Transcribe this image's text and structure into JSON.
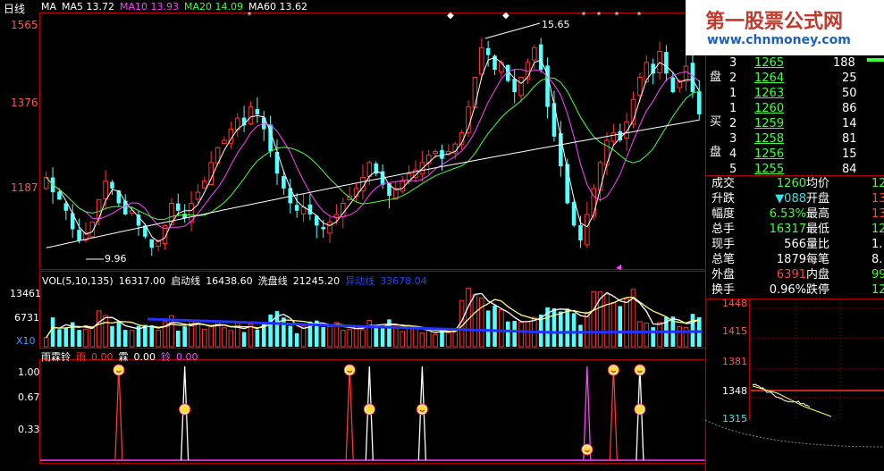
{
  "period": "日线",
  "ma_legend": [
    {
      "label": "MA",
      "color": "#ffffff"
    },
    {
      "label": "MA5 13.72",
      "color": "#ffffff"
    },
    {
      "label": "MA10 13.93",
      "color": "#ff44ff"
    },
    {
      "label": "MA20 14.09",
      "color": "#44ff44"
    },
    {
      "label": "MA60 13.62",
      "color": "#ffffff"
    }
  ],
  "price_axis": [
    "1565",
    "1376",
    "1187"
  ],
  "annotations": {
    "high": "15.65",
    "low": "9.96"
  },
  "vol_legend": [
    {
      "label": "VOL(5,10,135)",
      "color": "#ffffff"
    },
    {
      "label": "16317.00",
      "color": "#ffffff"
    },
    {
      "label": "启动线",
      "color": "#ffffff"
    },
    {
      "label": "16438.60",
      "color": "#ffffff"
    },
    {
      "label": "洗盘线",
      "color": "#ffffff"
    },
    {
      "label": "21245.20",
      "color": "#ffffff"
    },
    {
      "label": "异动线",
      "color": "#2244ff"
    },
    {
      "label": "33678.04",
      "color": "#2244ff"
    }
  ],
  "vol_axis": [
    "13461",
    "6731",
    "X10"
  ],
  "ind_legend": [
    {
      "label": "雨霖铃",
      "color": "#ffffff"
    },
    {
      "label": "雨",
      "color": "#ff3333"
    },
    {
      "label": "0.00",
      "color": "#ff3333"
    },
    {
      "label": "霖",
      "color": "#ffffff"
    },
    {
      "label": "0.00",
      "color": "#ffffff"
    },
    {
      "label": "铃",
      "color": "#ff44ff"
    },
    {
      "label": "0.00",
      "color": "#ff44ff"
    }
  ],
  "ind_axis": [
    "1.00",
    "0.67",
    "0.33"
  ],
  "order_book": {
    "sell_label": [
      "盘"
    ],
    "buy_label": [
      "买",
      "盘"
    ],
    "asks": [
      {
        "level": "3",
        "price": "1265",
        "vol": "188"
      },
      {
        "level": "2",
        "price": "1264",
        "vol": "25"
      },
      {
        "level": "1",
        "price": "1263",
        "vol": "50"
      }
    ],
    "bids": [
      {
        "level": "1",
        "price": "1260",
        "vol": "86"
      },
      {
        "level": "2",
        "price": "1259",
        "vol": "14"
      },
      {
        "level": "3",
        "price": "1258",
        "vol": "81"
      },
      {
        "level": "4",
        "price": "1256",
        "vol": "15"
      },
      {
        "level": "5",
        "price": "1255",
        "vol": "84"
      }
    ]
  },
  "quote": [
    {
      "l1": "成交",
      "v1": "1260",
      "l2": "均价",
      "v2": "12"
    },
    {
      "l1": "升跌",
      "v1": "▼088",
      "l2": "开盘",
      "v2": "13"
    },
    {
      "l1": "幅度",
      "v1": "6.53%",
      "l2": "最高",
      "v2": "13"
    },
    {
      "l1": "总手",
      "v1": "16317",
      "l2": "最低",
      "v2": "12"
    },
    {
      "l1": "现手",
      "v1": "566",
      "l2": "量比",
      "v2": "1."
    },
    {
      "l1": "总笔",
      "v1": "1879",
      "l2": "每笔",
      "v2": "8."
    },
    {
      "l1": "外盘",
      "v1": "6391",
      "l2": "内盘",
      "v2": "99"
    },
    {
      "l1": "换手",
      "v1": "0.96%",
      "l2": "跌停",
      "v2": "12"
    }
  ],
  "mini_axis": [
    "1448",
    "1415",
    "1381",
    "1348",
    "1315"
  ],
  "watermark": {
    "title": "第一股票公式网",
    "url": "www.chnmoney.com"
  },
  "colors": {
    "up": "#ff3333",
    "down": "#54ffff",
    "ma5": "#ffffff",
    "ma10": "#ff44ff",
    "ma20": "#44ff44",
    "ma60": "#ffffff",
    "frame": "#b00000"
  },
  "chart_data": [
    {
      "type": "candlestick",
      "ylim": [
        9.5,
        16.3
      ],
      "yticks": [
        15.65,
        13.76,
        11.87
      ],
      "closes": [
        11.9,
        11.5,
        11.3,
        11.0,
        10.5,
        10.2,
        10.4,
        10.7,
        11.3,
        11.8,
        11.6,
        11.2,
        10.9,
        11.0,
        10.6,
        10.3,
        10.0,
        10.2,
        10.6,
        11.2,
        11.0,
        10.8,
        11.2,
        11.5,
        11.8,
        12.3,
        12.7,
        12.9,
        13.2,
        13.5,
        13.3,
        13.8,
        13.6,
        13.2,
        12.6,
        12.0,
        11.6,
        11.2,
        11.0,
        11.1,
        10.9,
        10.6,
        10.5,
        10.7,
        10.9,
        11.2,
        11.4,
        11.6,
        11.9,
        12.3,
        12.0,
        11.7,
        11.4,
        11.6,
        11.8,
        12.0,
        12.1,
        12.3,
        12.5,
        12.6,
        12.4,
        12.6,
        12.8,
        13.1,
        13.8,
        14.6,
        15.4,
        15.2,
        14.8,
        15.0,
        14.5,
        14.2,
        14.6,
        15.0,
        15.4,
        14.8,
        13.8,
        13.0,
        12.2,
        11.2,
        10.6,
        10.2,
        10.9,
        11.6,
        12.3,
        12.9,
        13.1,
        12.9,
        13.4,
        14.0,
        14.6,
        15.0,
        14.7,
        15.3,
        14.7,
        14.2,
        14.5,
        14.9,
        14.2,
        13.6
      ],
      "lowest_label": 9.96,
      "highest_label": 15.65
    },
    {
      "type": "bar",
      "name": "volume",
      "ylim": [
        0,
        13461
      ],
      "yticks": [
        13461,
        6731
      ],
      "series": [
        {
          "name": "启动线",
          "last": 16438.6
        },
        {
          "name": "洗盘线",
          "last": 21245.2
        },
        {
          "name": "异动线",
          "last": 33678.04
        }
      ]
    },
    {
      "type": "line",
      "name": "雨霖铃",
      "ylim": [
        0,
        1
      ],
      "yticks": [
        1.0,
        0.67,
        0.33
      ],
      "series": [
        {
          "name": "雨",
          "last": 0.0
        },
        {
          "name": "霖",
          "last": 0.0
        },
        {
          "name": "铃",
          "last": 0.0
        }
      ],
      "signals": [
        {
          "series": "雨",
          "i": 11
        },
        {
          "series": "霖",
          "i": 21
        },
        {
          "series": "雨",
          "i": 46
        },
        {
          "series": "霖",
          "i": 49
        },
        {
          "series": "霖",
          "i": 57
        },
        {
          "series": "铃",
          "i": 82
        },
        {
          "series": "雨",
          "i": 86
        },
        {
          "series": "霖",
          "i": 90
        }
      ]
    }
  ]
}
